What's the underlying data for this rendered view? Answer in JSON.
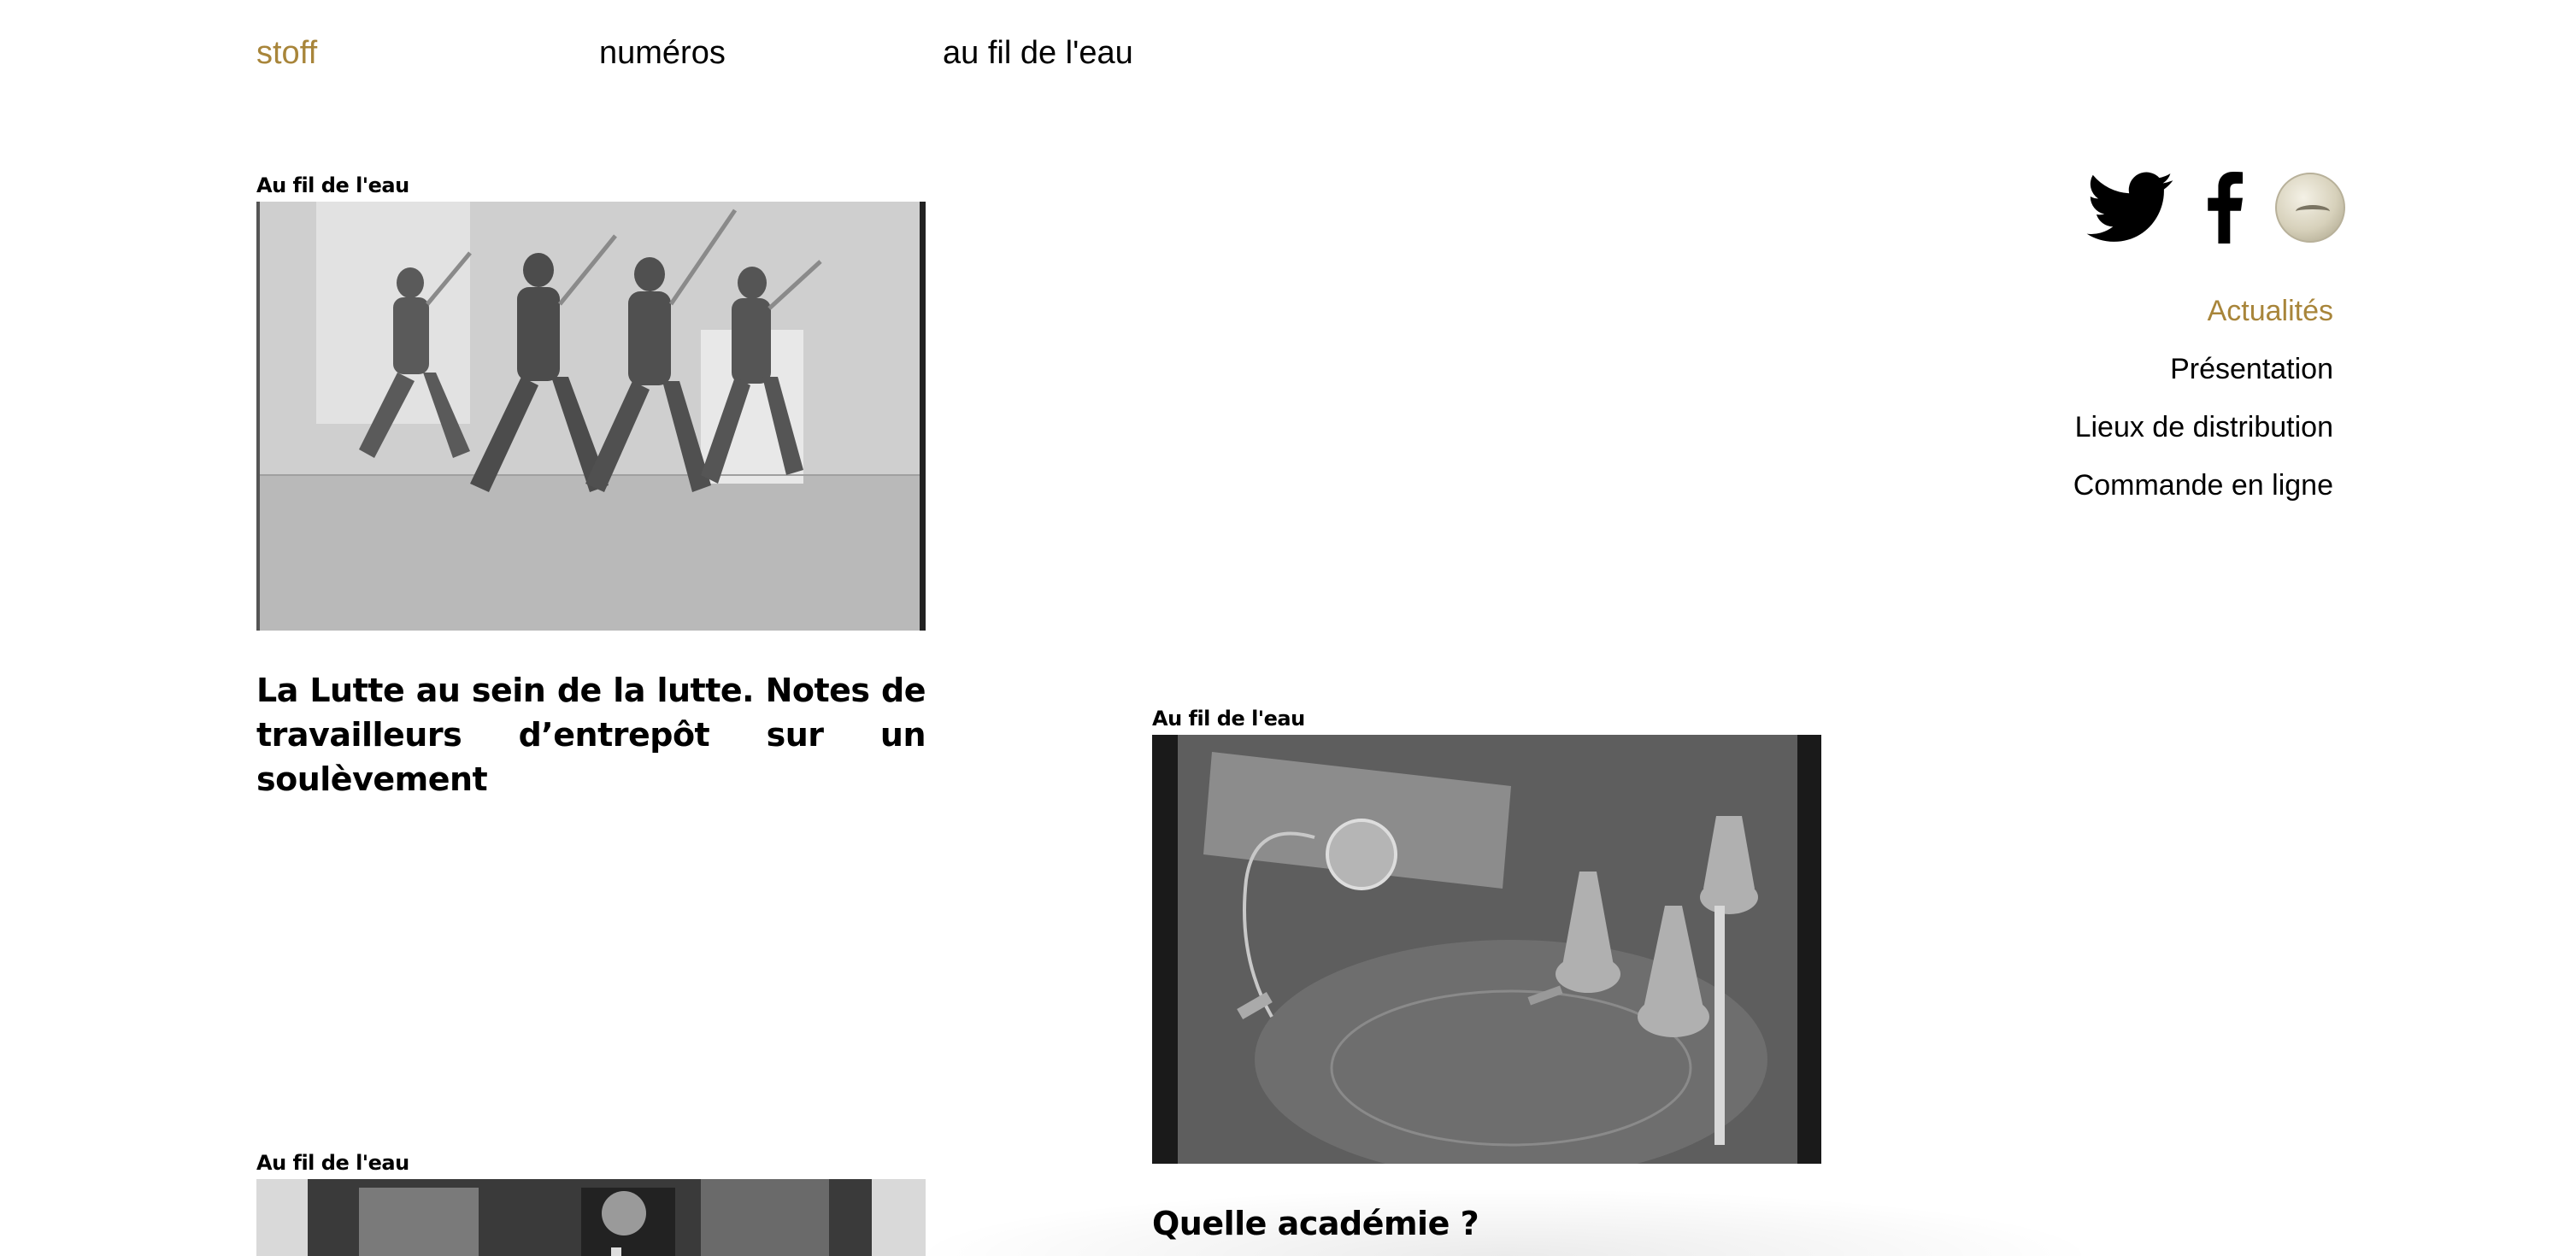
{
  "topnav": {
    "stoff": "stoff",
    "numeros": "numéros",
    "au_fil": "au fil de l'eau"
  },
  "articles": [
    {
      "category": "Au fil de l'eau",
      "image_alt": "black-and-white photo of dancers leaping with saxophones",
      "title": "La Lutte au sein de la lutte. Notes de travailleurs d’entrepôt sur un soulèvement"
    },
    {
      "category": "Au fil de l'eau",
      "image_alt": "black-and-white photo of medical instruments on an x-ray",
      "title": "Quelle académie ?"
    },
    {
      "category": "Au fil de l'eau",
      "image_alt": "black-and-white photo of people and a police officer",
      "title": ""
    }
  ],
  "social": {
    "icons": [
      "twitter-icon",
      "facebook-icon",
      "stoff-logo-icon"
    ]
  },
  "sidemenu": {
    "items": [
      {
        "label": "Actualités",
        "active": true
      },
      {
        "label": "Présentation",
        "active": false
      },
      {
        "label": "Lieux de distribution",
        "active": false
      },
      {
        "label": "Commande en ligne",
        "active": false
      }
    ]
  },
  "colors": {
    "accent": "#a8853a",
    "text": "#000000",
    "background": "#ffffff"
  }
}
